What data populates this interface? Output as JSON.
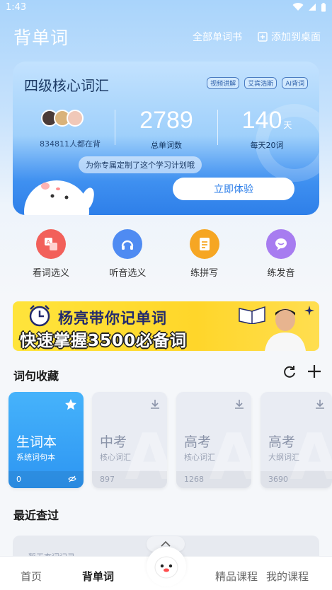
{
  "status_bar": {
    "time": "1:43"
  },
  "header": {
    "title": "背单词",
    "all_books_label": "全部单词书",
    "add_to_desktop_label": "添加到桌面"
  },
  "hero": {
    "title": "四级核心词汇",
    "tags": [
      "视频讲解",
      "艾宾浩斯",
      "AI背词"
    ],
    "learners_text": "834811人都在背",
    "total_words_value": "2789",
    "total_words_label": "总单词数",
    "daily_value": "140",
    "daily_unit": "天",
    "daily_label": "每天20词",
    "bubble_text": "为你专属定制了这个学习计划哦",
    "cta_label": "立即体验"
  },
  "quick_actions": [
    {
      "label": "看词选义",
      "icon": "translate-icon",
      "color": "#f2605a"
    },
    {
      "label": "听音选义",
      "icon": "headphone-icon",
      "color": "#4f8bf2"
    },
    {
      "label": "练拼写",
      "icon": "spelling-icon",
      "color": "#f6a623"
    },
    {
      "label": "练发音",
      "icon": "speech-icon",
      "color": "#a77cf0"
    }
  ],
  "banner": {
    "line1": "杨亮带你记单词",
    "line2": "快速掌握3500必备词"
  },
  "collections": {
    "title": "词句收藏",
    "cards": [
      {
        "name": "生词本",
        "sub": "系统词句本",
        "count": "0"
      },
      {
        "name": "中考",
        "sub": "核心词汇",
        "count": "897"
      },
      {
        "name": "高考",
        "sub": "核心词汇",
        "count": "1268"
      },
      {
        "name": "高考",
        "sub": "大纲词汇",
        "count": "3690"
      }
    ]
  },
  "recent": {
    "title": "最近查过",
    "item_text": "暂无查词记录"
  },
  "tabbar": {
    "home": "首页",
    "words": "背单词",
    "courses": "精品课程",
    "mine": "我的课程"
  },
  "colors": {
    "accent_blue": "#2e7fe9",
    "card_active": "#2d95f2",
    "banner_yellow": "#ffd62a"
  }
}
